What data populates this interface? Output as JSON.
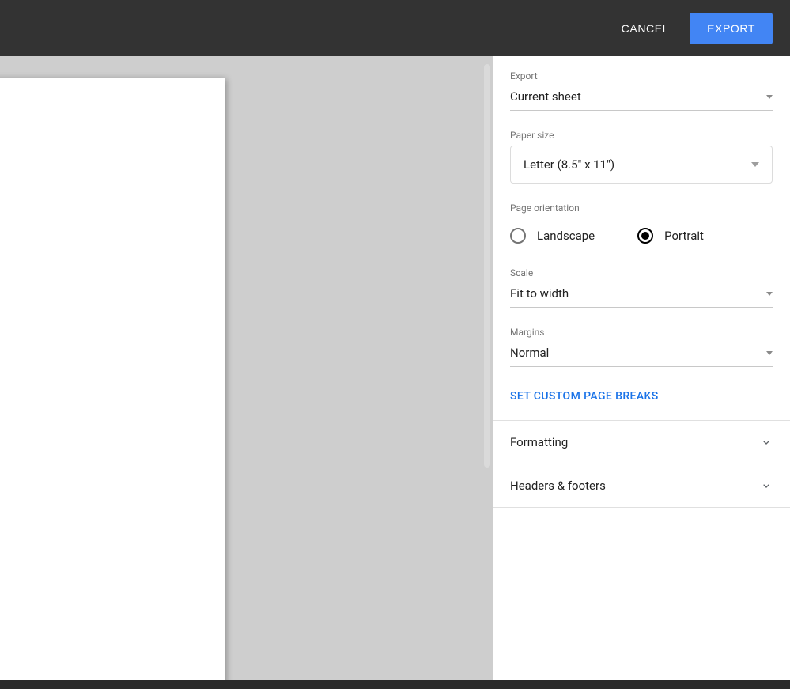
{
  "header": {
    "cancel_label": "CANCEL",
    "export_label": "EXPORT"
  },
  "sidebar": {
    "export": {
      "label": "Export",
      "value": "Current sheet"
    },
    "paper_size": {
      "label": "Paper size",
      "value": "Letter (8.5\" x 11\")"
    },
    "page_orientation": {
      "label": "Page orientation",
      "landscape_label": "Landscape",
      "portrait_label": "Portrait",
      "selected": "portrait"
    },
    "scale": {
      "label": "Scale",
      "value": "Fit to width"
    },
    "margins": {
      "label": "Margins",
      "value": "Normal"
    },
    "custom_page_breaks_label": "SET CUSTOM PAGE BREAKS",
    "accordion": {
      "formatting_label": "Formatting",
      "headers_footers_label": "Headers & footers"
    }
  }
}
